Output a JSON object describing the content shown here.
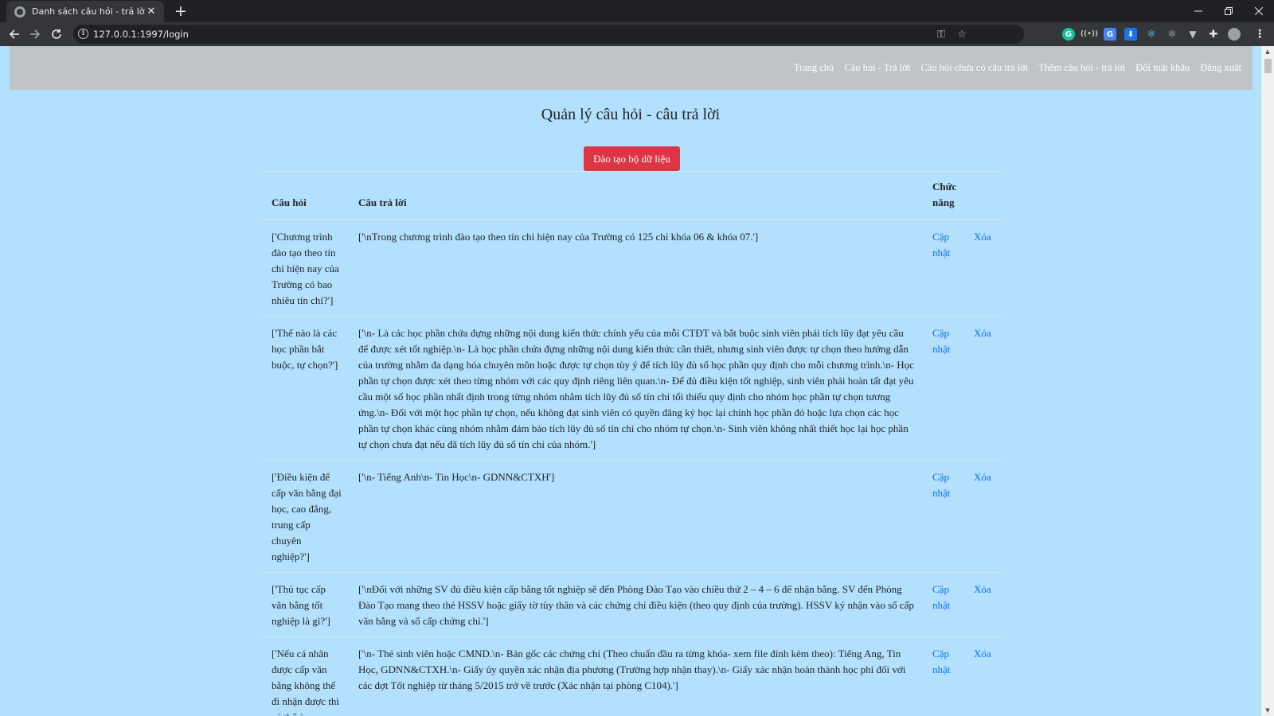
{
  "browser": {
    "tab_title": "Danh sách câu hỏi - trả lời",
    "url": "127.0.0.1:1997/login"
  },
  "navbar": {
    "links": [
      "Trang chủ",
      "Câu hỏi - Trả lời",
      "Câu hỏi chưa có câu trả lời",
      "Thêm câu hỏi - trả lời",
      "Đổi mật khẩu",
      "Đăng xuất"
    ]
  },
  "page": {
    "heading": "Quản lý câu hỏi - câu trả lời",
    "train_button": "Đào tạo bộ dữ liệu"
  },
  "table": {
    "headers": {
      "question": "Câu hỏi",
      "answer": "Câu trả lời",
      "function": "Chức năng"
    },
    "update_label": "Cập nhật",
    "delete_label": "Xóa",
    "rows": [
      {
        "question": "['Chương trình đào tạo theo tín chỉ hiện nay của Trường có bao nhiêu tín chỉ?']",
        "answer": "['\\nTrong chương trình đào tạo theo tín chỉ hiện nay của Trường có 125 chỉ khóa 06 & khóa 07.']"
      },
      {
        "question": "['Thế nào là các học phần bắt buộc, tự chọn?']",
        "answer": "['\\n- Là các học phần chứa đựng những nội dung kiến thức chính yếu của mỗi CTĐT và bắt buộc sinh viên phải tích lũy đạt yêu cầu để được xét tốt nghiệp.\\n- Là học phần chứa đựng những nội dung kiến thức cần thiết, nhưng sinh viên được tự chọn theo hướng dẫn của trường nhằm đa dạng hóa chuyên môn hoặc được tự chọn tùy ý để tích lũy đủ số học phần quy định cho mỗi chương trình.\\n- Học phần tự chọn được xét theo từng nhóm với các quy định riêng liên quan.\\n- Để đủ điều kiện tốt nghiệp, sinh viên phải hoàn tất đạt yêu cầu một số học phần nhất định trong từng nhóm nhằm tích lũy đủ số tín chỉ tối thiểu quy định cho nhóm học phần tự chọn tương ứng.\\n- Đối với một học phần tự chọn, nếu không đạt sinh viên có quyền đăng ký học lại chính học phần đó hoặc lựa chọn các học phần tự chọn khác cùng nhóm nhằm đảm bảo tích lũy đủ số tín chỉ cho nhóm tự chọn.\\n- Sinh viên không nhất thiết học lại học phần tự chọn chưa đạt nếu đã tích lũy đủ số tín chỉ của nhóm.']"
      },
      {
        "question": "['Điều kiện để cấp văn bằng đại học, cao đẳng, trung cấp chuyên nghiệp?']",
        "answer": "['\\n- Tiếng Anh\\n- Tin Học\\n- GDNN&CTXH']"
      },
      {
        "question": "['Thủ tục cấp văn bằng tốt nghiệp là gì?']",
        "answer": "['\\nĐối với những SV đủ điều kiện cấp bằng tốt nghiệp sẽ đến Phòng Đào Tạo vào chiều thứ 2 – 4 – 6 để nhận bằng. SV đến Phòng Đào Tạo mang theo thẻ HSSV hoặc giấy tờ tùy thân và các chứng chỉ điều kiện (theo quy định của trường). HSSV ký nhận vào sổ cấp văn bằng và sổ cấp chứng chỉ.']"
      },
      {
        "question": "['Nếu cá nhân được cấp văn bằng không thể đi nhận được thì có thể ủy quyền?']",
        "answer": "['\\n- Thẻ sinh viên hoặc CMND.\\n- Bản gốc các chứng chỉ (Theo chuẩn đầu ra từng khóa- xem file đính kèm theo): Tiếng Ang, Tin Học, GDNN&CTXH.\\n- Giấy ủy quyền xác nhận địa phương (Trường hợp nhận thay).\\n- Giấy xác nhận hoàn thành học phí đối với các đợt Tốt nghiệp từ tháng 5/2015 trở về trước (Xác nhận tại phòng C104).']"
      }
    ]
  },
  "colors": {
    "page_bg": "#b3e0fd",
    "navbar_bg": "#bfc4c8",
    "danger": "#dc3545",
    "link": "#0d6efd"
  }
}
